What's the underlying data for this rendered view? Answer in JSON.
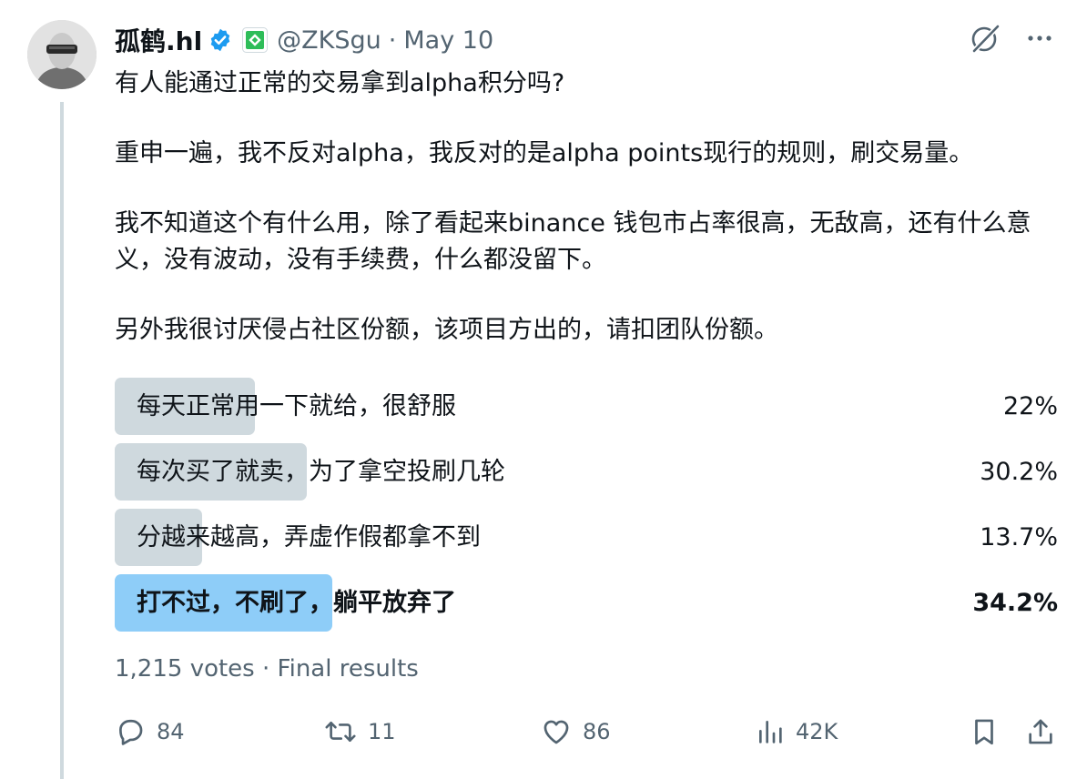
{
  "post": {
    "display_name": "孤鹤.hl",
    "handle": "@ZKSgu",
    "separator": "·",
    "date": "May 10",
    "text": [
      "有人能通过正常的交易拿到alpha积分吗?",
      "重申一遍，我不反对alpha，我反对的是alpha points现行的规则，刷交易量。",
      "我不知道这个有什么用，除了看起来binance 钱包市占率很高，无敌高，还有什么意义，没有波动，没有手续费，什么都没留下。",
      "另外我很讨厌侵占社区份额，该项目方出的，请扣团队份额。"
    ]
  },
  "poll": {
    "options": [
      {
        "label": "每天正常用一下就给，很舒服",
        "percent_text": "22%",
        "percent": 22.0,
        "winner": false
      },
      {
        "label": "每次买了就卖，为了拿空投刷几轮",
        "percent_text": "30.2%",
        "percent": 30.2,
        "winner": false
      },
      {
        "label": "分越来越高，弄虚作假都拿不到",
        "percent_text": "13.7%",
        "percent": 13.7,
        "winner": false
      },
      {
        "label": "打不过，不刷了，躺平放弃了",
        "percent_text": "34.2%",
        "percent": 34.2,
        "winner": true
      }
    ],
    "votes": "1,215 votes",
    "separator": "·",
    "status": "Final results"
  },
  "actions": {
    "replies": "84",
    "reposts": "11",
    "likes": "86",
    "views": "42K"
  },
  "icons": {
    "verified": "verified-badge-icon",
    "affiliate": "affiliate-badge-icon",
    "grok": "grok-icon",
    "more": "more-icon",
    "reply": "reply-icon",
    "repost": "repost-icon",
    "like": "like-icon",
    "views": "views-icon",
    "bookmark": "bookmark-icon",
    "share": "share-icon"
  },
  "colors": {
    "text": "#0f1419",
    "secondary_text": "#536471",
    "poll_bar": "#cfd9de",
    "poll_winner_bar": "#8ecdf8",
    "verified_blue": "#1d9bf0",
    "affiliate_green": "#2ebd59"
  }
}
